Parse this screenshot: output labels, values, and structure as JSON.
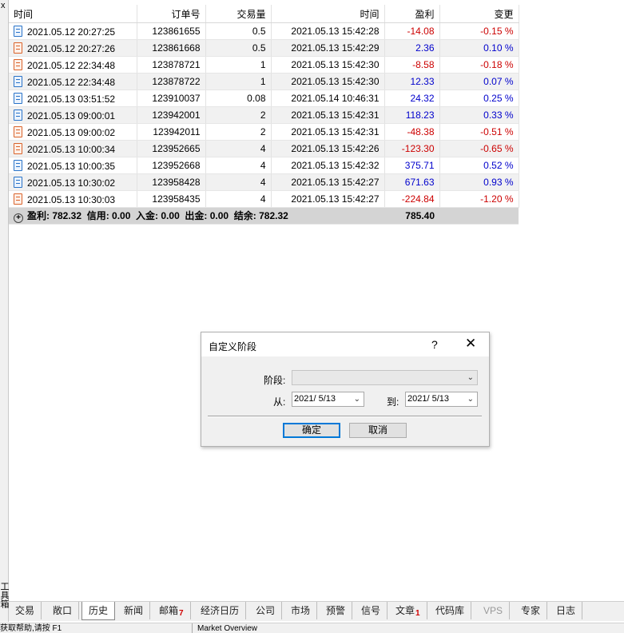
{
  "panel": {
    "close_glyph": "x",
    "vertical_label": "工具箱"
  },
  "table": {
    "headers": [
      "时间",
      "订单号",
      "交易量",
      "时间",
      "盈利",
      "变更"
    ],
    "rows": [
      {
        "type": "buy",
        "open_time": "2021.05.12 20:27:25",
        "order": "123861655",
        "volume": "0.5",
        "close_time": "2021.05.13 15:42:28",
        "profit": "-14.08",
        "change": "-0.15 %",
        "sign": "neg"
      },
      {
        "type": "sell",
        "open_time": "2021.05.12 20:27:26",
        "order": "123861668",
        "volume": "0.5",
        "close_time": "2021.05.13 15:42:29",
        "profit": "2.36",
        "change": "0.10 %",
        "sign": "pos"
      },
      {
        "type": "sell",
        "open_time": "2021.05.12 22:34:48",
        "order": "123878721",
        "volume": "1",
        "close_time": "2021.05.13 15:42:30",
        "profit": "-8.58",
        "change": "-0.18 %",
        "sign": "neg"
      },
      {
        "type": "buy",
        "open_time": "2021.05.12 22:34:48",
        "order": "123878722",
        "volume": "1",
        "close_time": "2021.05.13 15:42:30",
        "profit": "12.33",
        "change": "0.07 %",
        "sign": "pos"
      },
      {
        "type": "buy",
        "open_time": "2021.05.13 03:51:52",
        "order": "123910037",
        "volume": "0.08",
        "close_time": "2021.05.14 10:46:31",
        "profit": "24.32",
        "change": "0.25 %",
        "sign": "pos"
      },
      {
        "type": "buy",
        "open_time": "2021.05.13 09:00:01",
        "order": "123942001",
        "volume": "2",
        "close_time": "2021.05.13 15:42:31",
        "profit": "118.23",
        "change": "0.33 %",
        "sign": "pos"
      },
      {
        "type": "sell",
        "open_time": "2021.05.13 09:00:02",
        "order": "123942011",
        "volume": "2",
        "close_time": "2021.05.13 15:42:31",
        "profit": "-48.38",
        "change": "-0.51 %",
        "sign": "neg"
      },
      {
        "type": "sell",
        "open_time": "2021.05.13 10:00:34",
        "order": "123952665",
        "volume": "4",
        "close_time": "2021.05.13 15:42:26",
        "profit": "-123.30",
        "change": "-0.65 %",
        "sign": "neg"
      },
      {
        "type": "buy",
        "open_time": "2021.05.13 10:00:35",
        "order": "123952668",
        "volume": "4",
        "close_time": "2021.05.13 15:42:32",
        "profit": "375.71",
        "change": "0.52 %",
        "sign": "pos"
      },
      {
        "type": "buy",
        "open_time": "2021.05.13 10:30:02",
        "order": "123958428",
        "volume": "4",
        "close_time": "2021.05.13 15:42:27",
        "profit": "671.63",
        "change": "0.93 %",
        "sign": "pos"
      },
      {
        "type": "sell",
        "open_time": "2021.05.13 10:30:03",
        "order": "123958435",
        "volume": "4",
        "close_time": "2021.05.13 15:42:27",
        "profit": "-224.84",
        "change": "-1.20 %",
        "sign": "neg"
      }
    ],
    "summary": {
      "text": "盈利: 782.32  信用: 0.00  入金: 0.00  出金: 0.00  结余: 782.32",
      "total": "785.40"
    }
  },
  "dialog": {
    "title": "自定义阶段",
    "help": "?",
    "close": "✕",
    "period_label": "阶段:",
    "period_value": "",
    "from_label": "从:",
    "from_value": "2021/ 5/13",
    "to_label": "到:",
    "to_value": "2021/ 5/13",
    "ok": "确定",
    "cancel": "取消"
  },
  "tabs": [
    {
      "label": "交易"
    },
    {
      "label": "敞口"
    },
    {
      "label": "历史",
      "active": true
    },
    {
      "label": "新闻"
    },
    {
      "label": "邮箱",
      "badge": "7"
    },
    {
      "label": "经济日历"
    },
    {
      "label": "公司"
    },
    {
      "label": "市场"
    },
    {
      "label": "预警"
    },
    {
      "label": "信号"
    },
    {
      "label": "文章",
      "badge": "1"
    },
    {
      "label": "代码库"
    },
    {
      "label": "VPS",
      "dim": true
    },
    {
      "label": "专家"
    },
    {
      "label": "日志"
    }
  ],
  "status": {
    "left": "获取帮助,请按 F1",
    "market": "Market Overview"
  },
  "colors": {
    "negative": "#cc0000",
    "positive": "#0000cc",
    "summary_bg": "#d4d4d4"
  }
}
